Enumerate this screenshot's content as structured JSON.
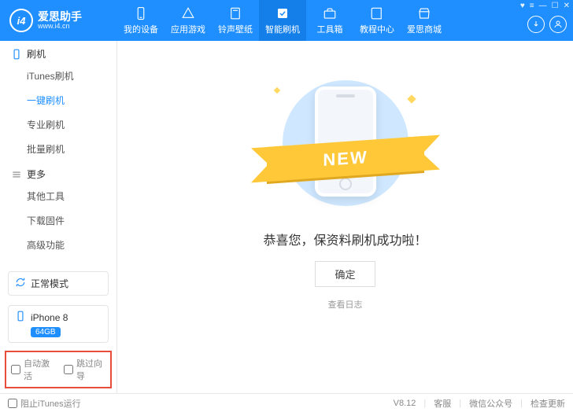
{
  "app": {
    "title": "爱思助手",
    "subtitle": "www.i4.cn",
    "logo_text": "i4"
  },
  "nav": [
    {
      "label": "我的设备"
    },
    {
      "label": "应用游戏"
    },
    {
      "label": "铃声壁纸"
    },
    {
      "label": "智能刷机"
    },
    {
      "label": "工具箱"
    },
    {
      "label": "教程中心"
    },
    {
      "label": "爱思商城"
    }
  ],
  "sidebar": {
    "section1": {
      "title": "刷机",
      "items": [
        "iTunes刷机",
        "一键刷机",
        "专业刷机",
        "批量刷机"
      ]
    },
    "section2": {
      "title": "更多",
      "items": [
        "其他工具",
        "下载固件",
        "高级功能"
      ]
    },
    "mode": "正常模式",
    "device": {
      "name": "iPhone 8",
      "storage": "64GB"
    },
    "checks": {
      "auto_activate": "自动激活",
      "skip_guide": "跳过向导"
    }
  },
  "main": {
    "ribbon": "NEW",
    "message": "恭喜您，保资料刷机成功啦！",
    "ok": "确定",
    "log": "查看日志"
  },
  "footer": {
    "block_itunes": "阻止iTunes运行",
    "version": "V8.12",
    "links": [
      "客服",
      "微信公众号",
      "检查更新"
    ]
  }
}
